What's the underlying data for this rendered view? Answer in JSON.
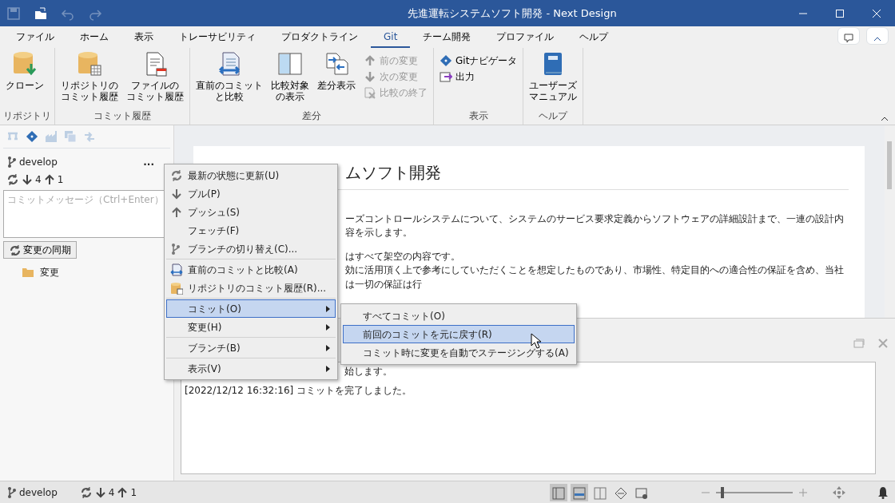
{
  "window": {
    "title": "先進運転システムソフト開発 - Next Design"
  },
  "quick_access": [
    {
      "disabled": true
    },
    {
      "disabled": false
    },
    {
      "disabled": true
    },
    {
      "disabled": true
    }
  ],
  "tabs": [
    {
      "label": "ファイル",
      "selected": false
    },
    {
      "label": "ホーム",
      "selected": false
    },
    {
      "label": "表示",
      "selected": false
    },
    {
      "label": "トレーサビリティ",
      "selected": false
    },
    {
      "label": "プロダクトライン",
      "selected": false
    },
    {
      "label": "Git",
      "selected": true
    },
    {
      "label": "チーム開発",
      "selected": false
    },
    {
      "label": "プロファイル",
      "selected": false
    },
    {
      "label": "ヘルプ",
      "selected": false
    }
  ],
  "ribbon": [
    {
      "label": "リポジトリ",
      "buttons": [
        {
          "kind": "large",
          "lines": [
            "クローン"
          ]
        }
      ]
    },
    {
      "label": "コミット履歴",
      "buttons": [
        {
          "kind": "large",
          "lines": [
            "リポジトリの",
            "コミット履歴"
          ]
        },
        {
          "kind": "large",
          "lines": [
            "ファイルの",
            "コミット履歴"
          ]
        }
      ]
    },
    {
      "label": "差分",
      "buttons": [
        {
          "kind": "large",
          "lines": [
            "直前のコミット",
            "と比較"
          ]
        },
        {
          "kind": "large",
          "lines": [
            "比較対象",
            "の表示"
          ]
        },
        {
          "kind": "large",
          "lines": [
            "差分表示"
          ]
        },
        {
          "kind": "small",
          "lines": [
            "前の変更"
          ],
          "disabled": true
        },
        {
          "kind": "small",
          "lines": [
            "次の変更"
          ],
          "disabled": true
        },
        {
          "kind": "small",
          "lines": [
            "比較の終了"
          ],
          "disabled": true
        }
      ]
    },
    {
      "label": "表示",
      "buttons": [
        {
          "kind": "small",
          "lines": [
            "Gitナビゲータ"
          ],
          "disabled": false
        },
        {
          "kind": "small",
          "lines": [
            "出力"
          ],
          "disabled": false
        }
      ]
    },
    {
      "label": "ヘルプ",
      "buttons": [
        {
          "kind": "large",
          "lines": [
            "ユーザーズ",
            "マニュアル"
          ]
        }
      ]
    }
  ],
  "left_panel": {
    "toolbar": [
      {
        "disabled": true
      },
      {
        "disabled": false
      },
      {
        "disabled": true
      },
      {
        "disabled": true
      },
      {
        "disabled": true
      }
    ],
    "branch": "develop",
    "more": "...",
    "incoming": "4",
    "outgoing": "1",
    "commit_message": {
      "placeholder": "コミットメッセージ（Ctrl+Enter）"
    },
    "sync_button": "変更の同期",
    "tree": [
      {
        "label": "変更"
      }
    ]
  },
  "document": {
    "heading": "ムソフト開発",
    "paragraphs": [
      "ーズコントロールシステムについて、システムのサービス要求定義からソフトウェアの詳細設計まで、一連の設計内容を示します。",
      "はすべて架空の内容です。",
      "効に活用頂く上で参考にしていただくことを想定したものであり、市場性、特定目的への適合性の保証を含め、当社は一切の保証は行"
    ]
  },
  "output": {
    "lines": [
      "始します。",
      "[2022/12/12 16:32:16] コミットを完了しました。"
    ]
  },
  "context_menu": {
    "groups": [
      [
        {
          "kind": "item",
          "label": "最新の状態に更新(U)",
          "selected": false
        },
        {
          "kind": "item",
          "label": "プル(P)",
          "selected": false
        },
        {
          "kind": "item",
          "label": "プッシュ(S)",
          "selected": false
        },
        {
          "kind": "item",
          "label": "フェッチ(F)",
          "selected": false
        },
        {
          "kind": "item",
          "label": "ブランチの切り替え(C)...",
          "selected": false
        }
      ],
      [
        {
          "kind": "item",
          "label": "直前のコミットと比較(A)",
          "selected": false
        },
        {
          "kind": "item",
          "label": "リポジトリのコミット履歴(R)...",
          "selected": false
        }
      ],
      [
        {
          "kind": "submenu",
          "label": "コミット(O)",
          "selected": true
        },
        {
          "kind": "submenu",
          "label": "変更(H)",
          "selected": false
        }
      ],
      [
        {
          "kind": "submenu",
          "label": "ブランチ(B)",
          "selected": false
        }
      ],
      [
        {
          "kind": "submenu",
          "label": "表示(V)",
          "selected": false
        }
      ]
    ],
    "submenu": [
      {
        "label": "すべてコミット(O)",
        "selected": false
      },
      {
        "label": "前回のコミットを元に戻す(R)",
        "selected": true
      },
      {
        "label": "コミット時に変更を自動でステージングする(A)",
        "selected": false
      }
    ]
  },
  "status_bar": {
    "branch": "develop",
    "incoming": "4",
    "outgoing": "1",
    "layouts": [
      {
        "selected": true
      },
      {
        "selected": true
      },
      {
        "selected": false
      },
      {
        "selected": false
      },
      {
        "selected": false
      }
    ],
    "zoom": {
      "level": 0.06
    }
  }
}
